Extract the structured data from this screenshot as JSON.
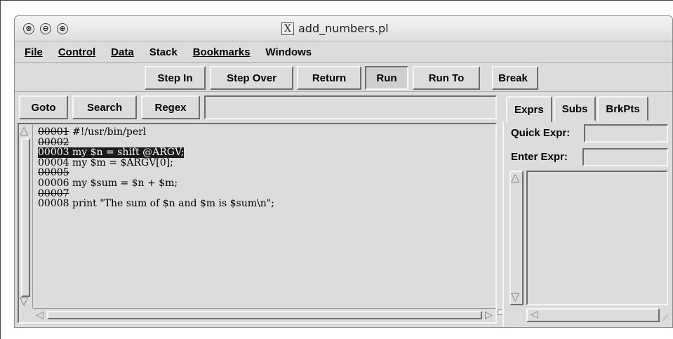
{
  "window": {
    "title": "add_numbers.pl",
    "title_icon": "X"
  },
  "titlebar_buttons": {
    "close": "⊗",
    "minimize": "⊖",
    "maximize": "⊕"
  },
  "menu": [
    {
      "label": "File"
    },
    {
      "label": "Control"
    },
    {
      "label": "Data"
    },
    {
      "label": "Stack"
    },
    {
      "label": "Bookmarks"
    },
    {
      "label": "Windows"
    }
  ],
  "toolbar": {
    "step_in": "Step In",
    "step_over": "Step Over",
    "return": "Return",
    "run": "Run",
    "run_to": "Run To",
    "break": "Break"
  },
  "search": {
    "goto": "Goto",
    "search": "Search",
    "regex": "Regex",
    "value": ""
  },
  "code_lines": [
    {
      "num": "00001",
      "text": " #!/usr/bin/perl"
    },
    {
      "num": "00002",
      "text": ""
    },
    {
      "num": "00003",
      "text": " my $n = shift @ARGV;"
    },
    {
      "num": "00004",
      "text": " my $m = $ARGV[0];"
    },
    {
      "num": "00005",
      "text": ""
    },
    {
      "num": "00006",
      "text": " my $sum = $n + $m;"
    },
    {
      "num": "00007",
      "text": ""
    },
    {
      "num": "00008",
      "text": " print \"The sum of $n and $m is $sum\\n\";"
    }
  ],
  "tabs": {
    "exprs": "Exprs",
    "subs": "Subs",
    "brkpts": "BrkPts"
  },
  "exprs": {
    "quick_label": "Quick Expr:",
    "enter_label": "Enter Expr:",
    "quick_value": "",
    "enter_value": ""
  }
}
